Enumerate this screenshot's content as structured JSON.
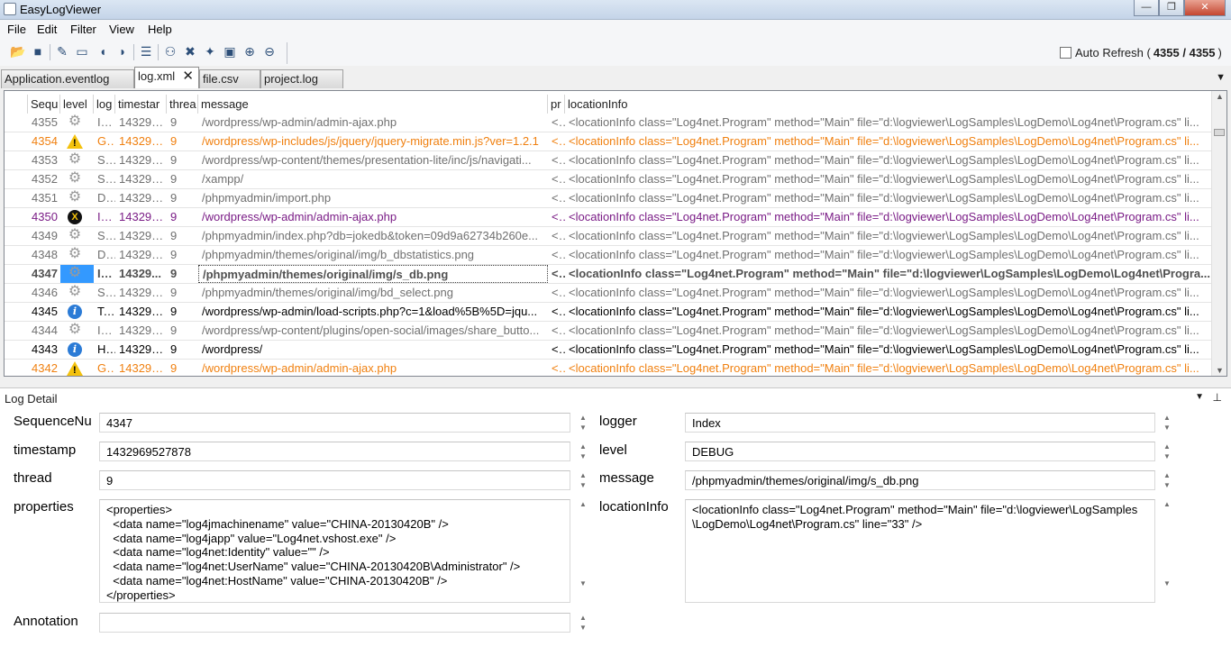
{
  "window": {
    "title": "EasyLogViewer",
    "min_label": "—",
    "max_label": "❐",
    "close_label": "✕"
  },
  "menu": [
    "File",
    "Edit",
    "Filter",
    "View",
    "Help"
  ],
  "toolbar": {
    "icons": [
      "open-folder-icon",
      "save-icon",
      "edit-icon",
      "rectangle-icon",
      "bubble-left-icon",
      "bubble-right-icon",
      "list-icon",
      "binoculars-icon",
      "tools-icon",
      "pin-icon",
      "window-icon",
      "zoom-in-icon",
      "zoom-out-icon"
    ],
    "auto_refresh_label": "Auto Refresh (",
    "counts": "4355 / 4355",
    "close_paren": ")"
  },
  "tabs": [
    {
      "label": "Application.eventlog",
      "active": false
    },
    {
      "label": "log.xml",
      "active": true
    },
    {
      "label": "file.csv",
      "active": false
    },
    {
      "label": "project.log",
      "active": false
    }
  ],
  "grid": {
    "columns": [
      "Sequ",
      "level",
      "log",
      "timestar",
      "threa",
      "message",
      "pr",
      "locationInfo"
    ],
    "rows": [
      {
        "seq": "4355",
        "level": "debug",
        "logger": "In...",
        "ts": "143296...",
        "thread": "9",
        "message": "/wordpress/wp-admin/admin-ajax.php",
        "pr": "<...",
        "loc": "<locationInfo class=\"Log4net.Program\" method=\"Main\" file=\"d:\\logviewer\\LogSamples\\LogDemo\\Log4net\\Program.cs\" li..."
      },
      {
        "seq": "4354",
        "level": "warn",
        "logger": "Gl...",
        "ts": "143296...",
        "thread": "9",
        "message": "/wordpress/wp-includes/js/jquery/jquery-migrate.min.js?ver=1.2.1",
        "pr": "<...",
        "loc": "<locationInfo class=\"Log4net.Program\" method=\"Main\" file=\"d:\\logviewer\\LogSamples\\LogDemo\\Log4net\\Program.cs\" li..."
      },
      {
        "seq": "4353",
        "level": "debug",
        "logger": "St...",
        "ts": "143296...",
        "thread": "9",
        "message": "/wordpress/wp-content/themes/presentation-lite/inc/js/navigati...",
        "pr": "<...",
        "loc": "<locationInfo class=\"Log4net.Program\" method=\"Main\" file=\"d:\\logviewer\\LogSamples\\LogDemo\\Log4net\\Program.cs\" li..."
      },
      {
        "seq": "4352",
        "level": "debug",
        "logger": "St...",
        "ts": "143296...",
        "thread": "9",
        "message": "/xampp/",
        "pr": "<...",
        "loc": "<locationInfo class=\"Log4net.Program\" method=\"Main\" file=\"d:\\logviewer\\LogSamples\\LogDemo\\Log4net\\Program.cs\" li..."
      },
      {
        "seq": "4351",
        "level": "debug",
        "logger": "D...",
        "ts": "143296...",
        "thread": "9",
        "message": "/phpmyadmin/import.php",
        "pr": "<...",
        "loc": "<locationInfo class=\"Log4net.Program\" method=\"Main\" file=\"d:\\logviewer\\LogSamples\\LogDemo\\Log4net\\Program.cs\" li..."
      },
      {
        "seq": "4350",
        "level": "fatal",
        "logger": "In...",
        "ts": "143296...",
        "thread": "9",
        "message": "/wordpress/wp-admin/admin-ajax.php",
        "pr": "<...",
        "loc": "<locationInfo class=\"Log4net.Program\" method=\"Main\" file=\"d:\\logviewer\\LogSamples\\LogDemo\\Log4net\\Program.cs\" li..."
      },
      {
        "seq": "4349",
        "level": "debug",
        "logger": "Sa...",
        "ts": "143296...",
        "thread": "9",
        "message": "/phpmyadmin/index.php?db=jokedb&token=09d9a62734b260e...",
        "pr": "<...",
        "loc": "<locationInfo class=\"Log4net.Program\" method=\"Main\" file=\"d:\\logviewer\\LogSamples\\LogDemo\\Log4net\\Program.cs\" li..."
      },
      {
        "seq": "4348",
        "level": "debug",
        "logger": "D...",
        "ts": "143296...",
        "thread": "9",
        "message": "/phpmyadmin/themes/original/img/b_dbstatistics.png",
        "pr": "<...",
        "loc": "<locationInfo class=\"Log4net.Program\" method=\"Main\" file=\"d:\\logviewer\\LogSamples\\LogDemo\\Log4net\\Program.cs\" li..."
      },
      {
        "seq": "4347",
        "level": "debug",
        "selected": true,
        "logger": "In...",
        "ts": "14329...",
        "thread": "9",
        "message": "/phpmyadmin/themes/original/img/s_db.png",
        "pr": "<...",
        "loc": "<locationInfo class=\"Log4net.Program\" method=\"Main\" file=\"d:\\logviewer\\LogSamples\\LogDemo\\Log4net\\Progra..."
      },
      {
        "seq": "4346",
        "level": "debug",
        "logger": "Sa...",
        "ts": "143296...",
        "thread": "9",
        "message": "/phpmyadmin/themes/original/img/bd_select.png",
        "pr": "<...",
        "loc": "<locationInfo class=\"Log4net.Program\" method=\"Main\" file=\"d:\\logviewer\\LogSamples\\LogDemo\\Log4net\\Program.cs\" li..."
      },
      {
        "seq": "4345",
        "level": "info",
        "logger": "Test",
        "ts": "143296...",
        "thread": "9",
        "message": "/wordpress/wp-admin/load-scripts.php?c=1&load%5B%5D=jqu...",
        "pr": "<...",
        "loc": "<locationInfo class=\"Log4net.Program\" method=\"Main\" file=\"d:\\logviewer\\LogSamples\\LogDemo\\Log4net\\Program.cs\" li..."
      },
      {
        "seq": "4344",
        "level": "debug",
        "logger": "In...",
        "ts": "143296...",
        "thread": "9",
        "message": "/wordpress/wp-content/plugins/open-social/images/share_butto...",
        "pr": "<...",
        "loc": "<locationInfo class=\"Log4net.Program\" method=\"Main\" file=\"d:\\logviewer\\LogSamples\\LogDemo\\Log4net\\Program.cs\" li..."
      },
      {
        "seq": "4343",
        "level": "info",
        "logger": "H...",
        "ts": "143296...",
        "thread": "9",
        "message": "/wordpress/",
        "pr": "<...",
        "loc": "<locationInfo class=\"Log4net.Program\" method=\"Main\" file=\"d:\\logviewer\\LogSamples\\LogDemo\\Log4net\\Program.cs\" li..."
      },
      {
        "seq": "4342",
        "level": "warn",
        "logger": "Gl...",
        "ts": "143296...",
        "thread": "9",
        "message": "/wordpress/wp-admin/admin-ajax.php",
        "pr": "<...",
        "loc": "<locationInfo class=\"Log4net.Program\" method=\"Main\" file=\"d:\\logviewer\\LogSamples\\LogDemo\\Log4net\\Program.cs\" li..."
      }
    ]
  },
  "detail": {
    "title": "Log Detail",
    "fields_left": [
      {
        "label": "SequenceNu",
        "value": "4347"
      },
      {
        "label": "timestamp",
        "value": "1432969527878"
      },
      {
        "label": "thread",
        "value": "9"
      },
      {
        "label": "properties",
        "value": "<properties>\n  <data name=\"log4jmachinename\" value=\"CHINA-20130420B\" />\n  <data name=\"log4japp\" value=\"Log4net.vshost.exe\" />\n  <data name=\"log4net:Identity\" value=\"\" />\n  <data name=\"log4net:UserName\" value=\"CHINA-20130420B\\Administrator\" />\n  <data name=\"log4net:HostName\" value=\"CHINA-20130420B\" />\n</properties>"
      },
      {
        "label": "Annotation",
        "value": ""
      }
    ],
    "fields_right": [
      {
        "label": "logger",
        "value": "Index"
      },
      {
        "label": "level",
        "value": "DEBUG"
      },
      {
        "label": "message",
        "value": "/phpmyadmin/themes/original/img/s_db.png"
      },
      {
        "label": "locationInfo",
        "value": "<locationInfo class=\"Log4net.Program\" method=\"Main\" file=\"d:\\logviewer\\LogSamples\n\\LogDemo\\Log4net\\Program.cs\" line=\"33\" />"
      }
    ]
  },
  "colors": {
    "info": "#000000",
    "warn": "#f08010",
    "fatal": "#7a1c86",
    "debug": "#707070",
    "selection": "#3399ff"
  }
}
